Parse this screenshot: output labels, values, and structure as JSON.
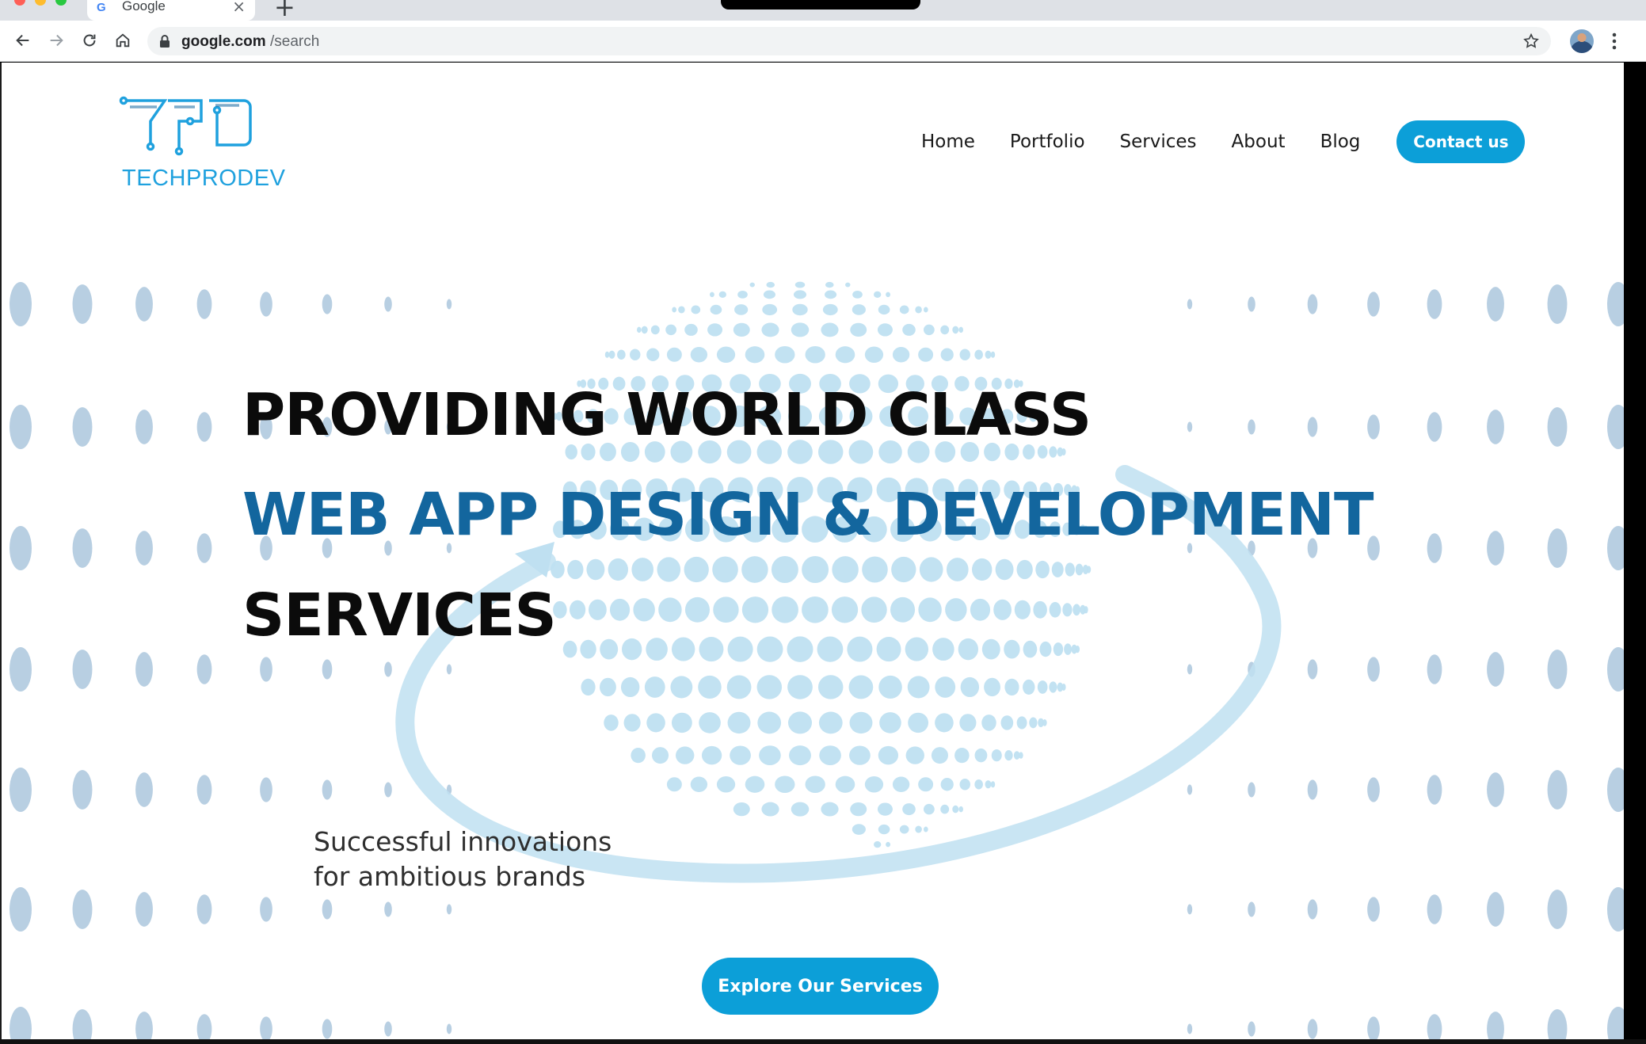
{
  "browser": {
    "tab_title": "Google",
    "tab_favicon": "G",
    "tab_close": "×",
    "new_tab": "+",
    "url_host": "google.com",
    "url_path": "/search",
    "icons": [
      "back-arrow-icon",
      "forward-arrow-icon",
      "reload-icon",
      "home-icon",
      "lock-icon",
      "bookmark-star-icon",
      "profile-avatar",
      "kebab-menu-icon"
    ]
  },
  "site": {
    "logo_text": "TECHPRODEV",
    "nav": [
      "Home",
      "Portfolio",
      "Services",
      "About",
      "Blog"
    ],
    "contact_label": "Contact us"
  },
  "hero": {
    "line1": "PROVIDING WORLD CLASS",
    "line2": "WEB APP DESIGN & DEVELOPMENT",
    "line3": "SERVICES",
    "tagline1": "Successful innovations",
    "tagline2": "for ambitious brands",
    "cta_label": "Explore Our Services"
  },
  "colors": {
    "accent": "#0c9fd8",
    "headline_blue": "#13669e",
    "dots": "#b8cfe2",
    "globe": "#bfe0f1"
  }
}
